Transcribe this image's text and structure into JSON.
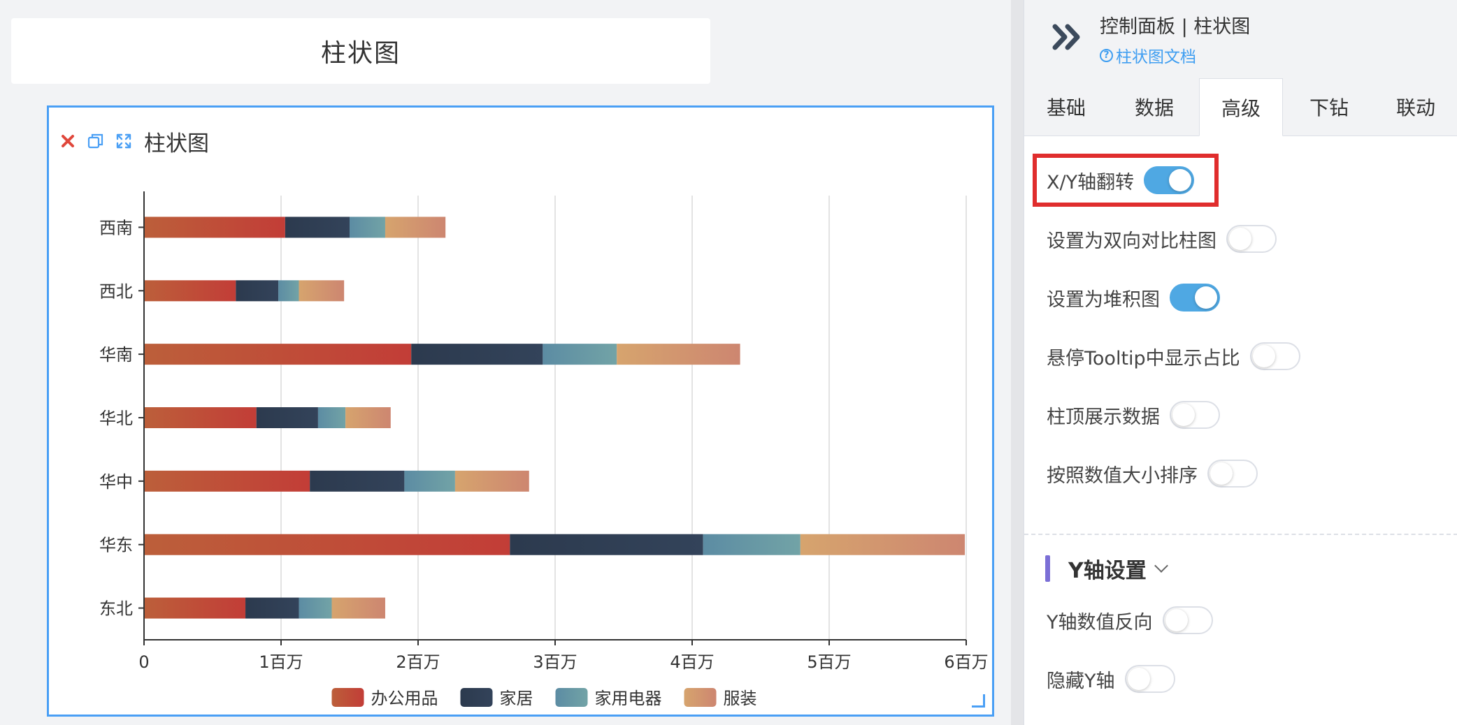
{
  "page_title": "柱状图",
  "chart_card": {
    "title": "柱状图"
  },
  "panel": {
    "title": "控制面板 | 柱状图",
    "doc_link": "柱状图文档",
    "tabs": [
      {
        "label": "基础",
        "active": false
      },
      {
        "label": "数据",
        "active": false
      },
      {
        "label": "高级",
        "active": true
      },
      {
        "label": "下钻",
        "active": false
      },
      {
        "label": "联动",
        "active": false
      }
    ],
    "options": [
      {
        "label": "X/Y轴翻转",
        "on": true
      },
      {
        "label": "设置为双向对比柱图",
        "on": false
      },
      {
        "label": "设置为堆积图",
        "on": true
      },
      {
        "label": "悬停Tooltip中显示占比",
        "on": false
      },
      {
        "label": "柱顶展示数据",
        "on": false
      },
      {
        "label": "按照数值大小排序",
        "on": false
      }
    ],
    "y_section": {
      "title": "Y轴设置",
      "options": [
        {
          "label": "Y轴数值反向",
          "on": false
        },
        {
          "label": "隐藏Y轴",
          "on": false
        }
      ]
    }
  },
  "colors": {
    "accent": "#4a9ff5",
    "highlight": "#e02d2d",
    "switch_on": "#4fa8e3",
    "section_bar": "#7b6fd6"
  },
  "chart_data": {
    "type": "bar",
    "orientation": "horizontal",
    "stacked": true,
    "categories": [
      "西南",
      "西北",
      "华南",
      "华北",
      "华中",
      "华东",
      "东北"
    ],
    "series": [
      {
        "name": "办公用品",
        "color_start": "#bc5f3a",
        "color_end": "#c23d37",
        "values": [
          1030000,
          670000,
          1950000,
          820000,
          1210000,
          2670000,
          740000
        ]
      },
      {
        "name": "家居",
        "color_start": "#2c3a4e",
        "color_end": "#33435a",
        "values": [
          470000,
          310000,
          960000,
          450000,
          690000,
          1410000,
          390000
        ]
      },
      {
        "name": "家用电器",
        "color_start": "#5c8ca3",
        "color_end": "#72a3a6",
        "values": [
          260000,
          150000,
          540000,
          200000,
          370000,
          710000,
          240000
        ]
      },
      {
        "name": "服装",
        "color_start": "#d6a46e",
        "color_end": "#cd8670",
        "values": [
          440000,
          330000,
          900000,
          330000,
          540000,
          1200000,
          390000
        ]
      }
    ],
    "x_ticks": [
      "0",
      "1百万",
      "2百万",
      "3百万",
      "4百万",
      "5百万",
      "6百万"
    ],
    "xlim": [
      0,
      6000000
    ],
    "grid": true,
    "legend_position": "bottom-center"
  }
}
